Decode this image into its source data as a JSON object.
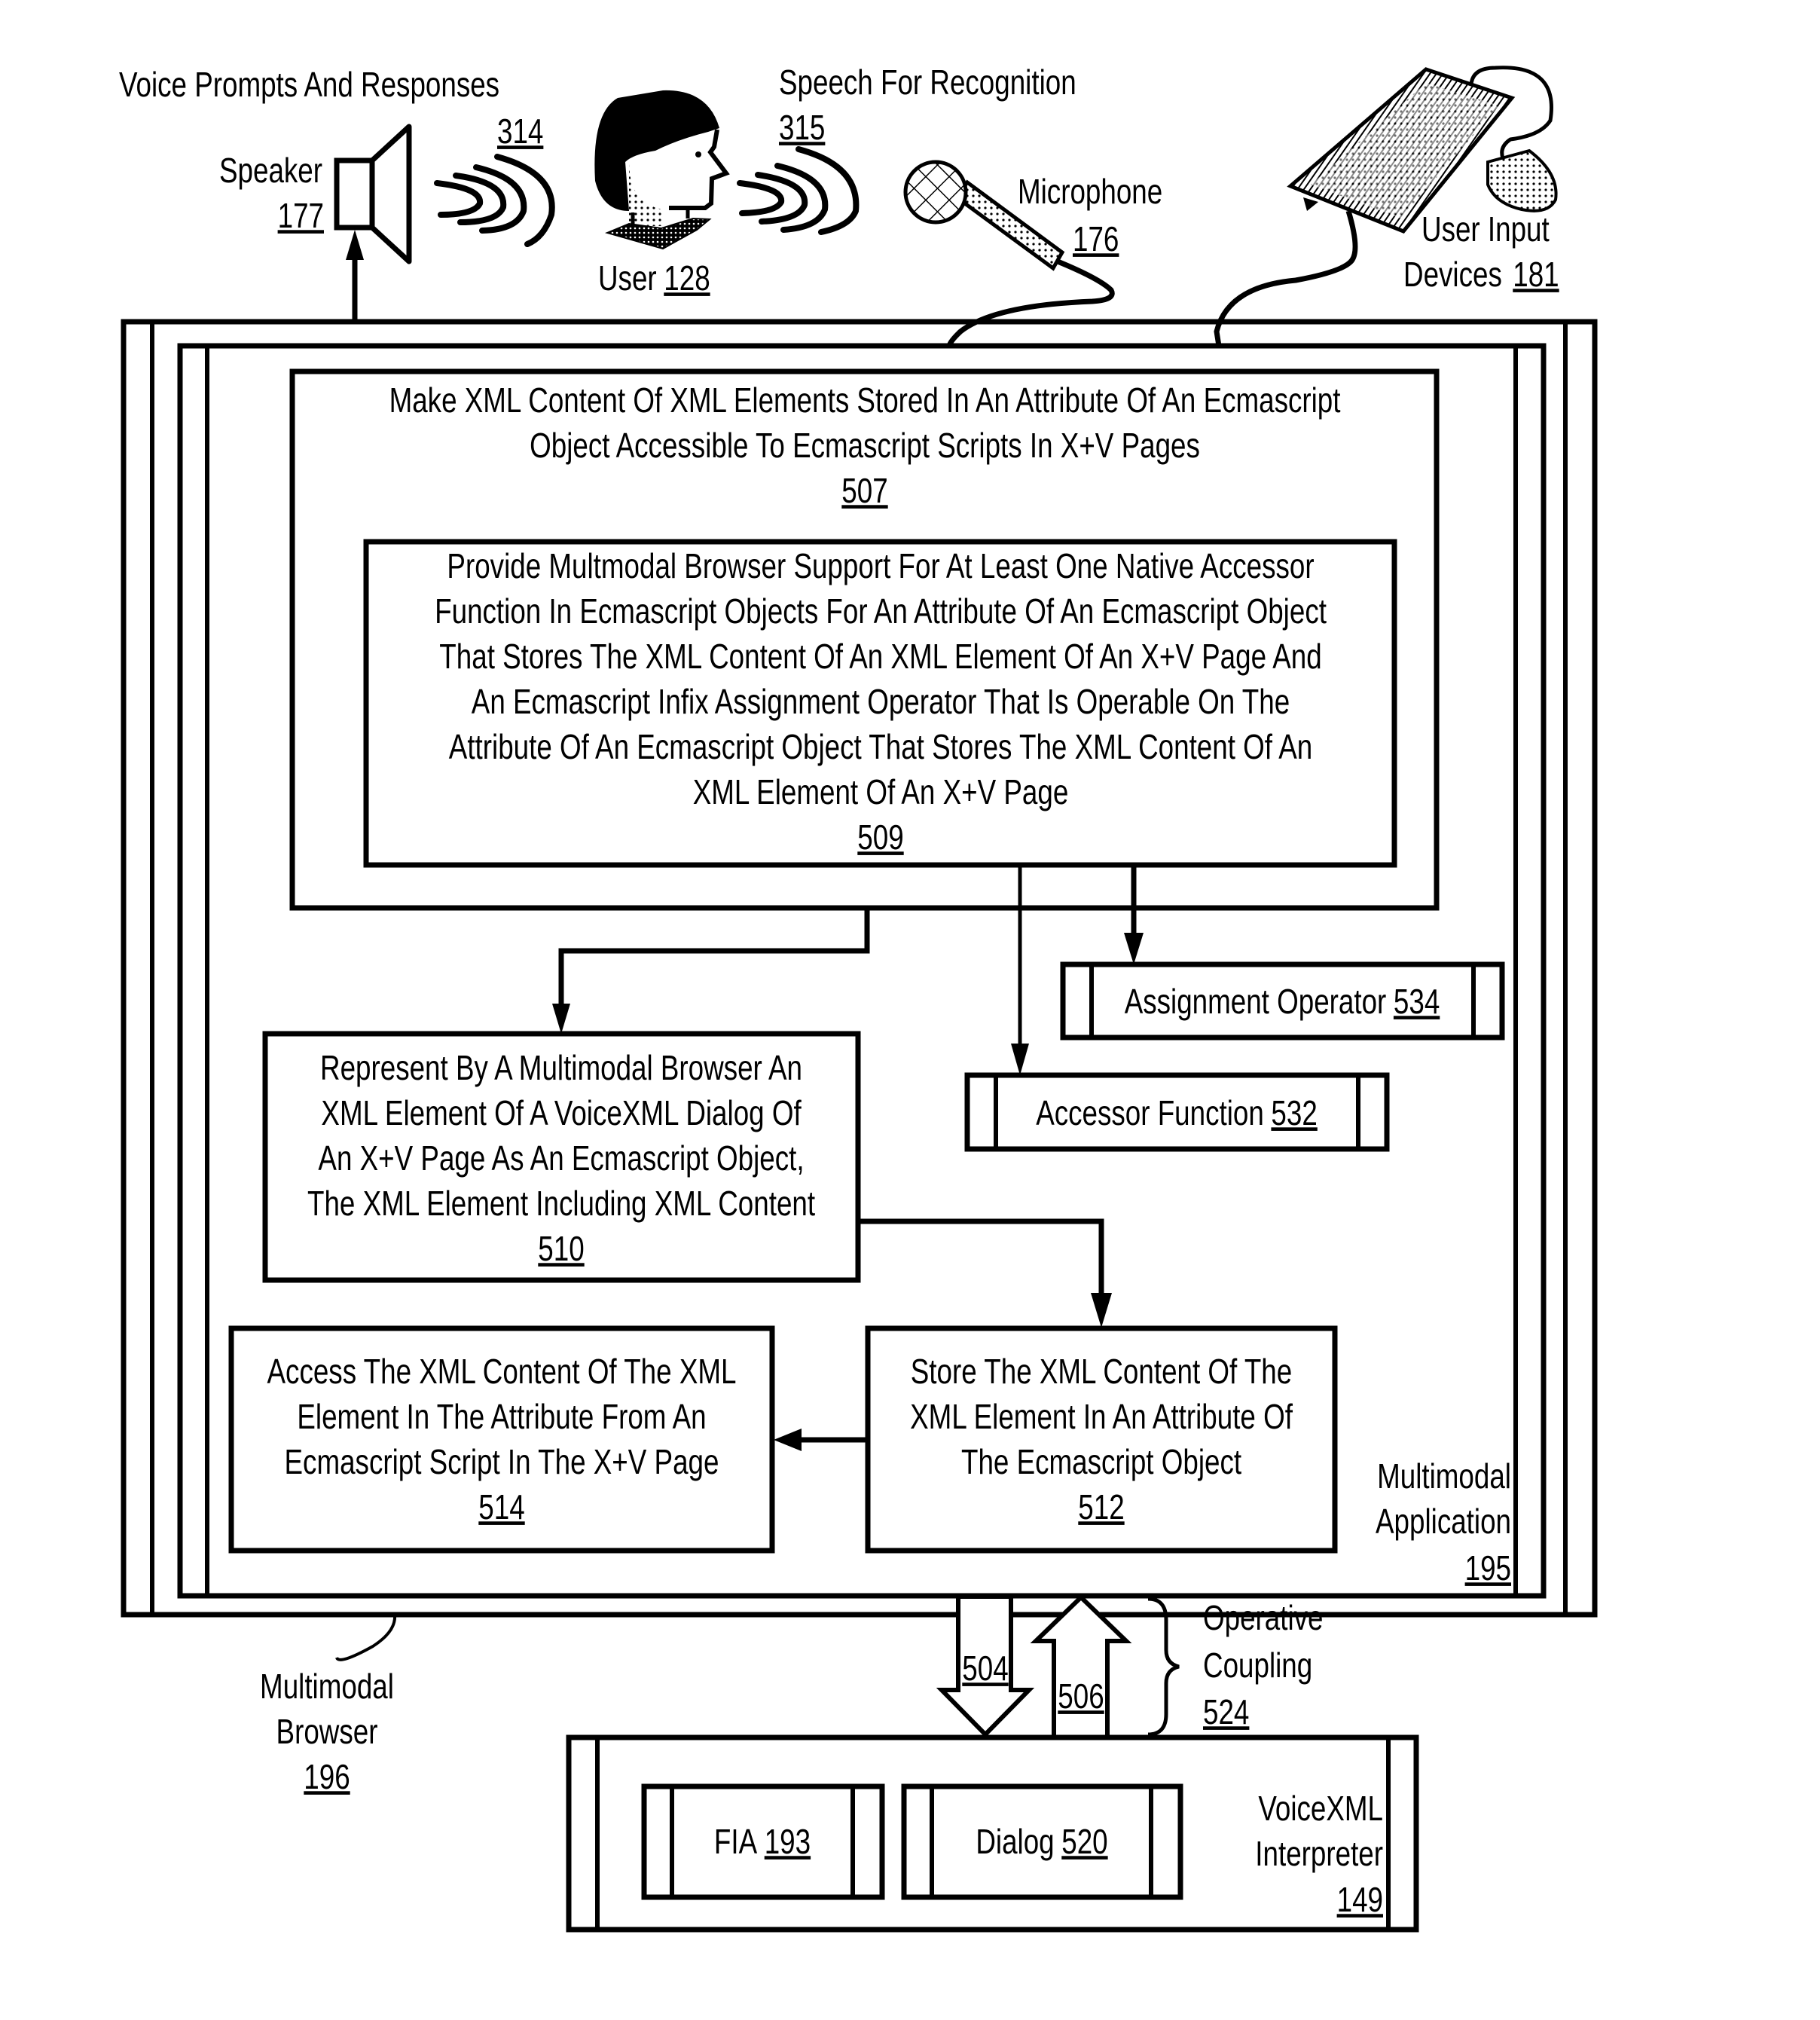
{
  "colors": {
    "ink": "#000000",
    "paper": "#ffffff"
  },
  "peripherals": {
    "voice_prompts": {
      "label": "Voice Prompts And Responses",
      "ref": "314"
    },
    "speaker": {
      "label": "Speaker",
      "ref": "177"
    },
    "user": {
      "label": "User",
      "ref": "128"
    },
    "speech": {
      "label": "Speech For Recognition",
      "ref": "315"
    },
    "microphone": {
      "label": "Microphone",
      "ref": "176"
    },
    "input_devices": {
      "label_line1": "User Input",
      "label_line2": "Devices",
      "ref": "181"
    }
  },
  "boxes": {
    "b507": {
      "lines": [
        "Make XML Content Of XML Elements Stored In An Attribute Of An Ecmascript",
        "Object Accessible To Ecmascript Scripts In X+V Pages"
      ],
      "ref": "507"
    },
    "b509": {
      "lines": [
        "Provide Multmodal Browser Support For At Least One Native Accessor",
        "Function In Ecmascript Objects For An Attribute Of An Ecmascript Object",
        "That Stores The XML Content Of An XML Element Of An X+V Page And",
        "An Ecmascript Infix Assignment Operator That Is Operable On The",
        "Attribute Of An Ecmascript Object That Stores The XML Content Of An",
        "XML Element Of An X+V Page"
      ],
      "ref": "509"
    },
    "b534": {
      "label": "Assignment Operator",
      "ref": "534"
    },
    "b532": {
      "label": "Accessor Function",
      "ref": "532"
    },
    "b510": {
      "lines": [
        "Represent By A Multimodal Browser An",
        "XML Element Of A VoiceXML Dialog Of",
        "An X+V Page As An Ecmascript Object,",
        "The XML Element Including XML Content"
      ],
      "ref": "510"
    },
    "b512": {
      "lines": [
        "Store The XML Content Of The",
        "XML Element In An Attribute Of",
        "The Ecmascript Object"
      ],
      "ref": "512"
    },
    "b514": {
      "lines": [
        "Access The XML Content Of The XML",
        "Element In The Attribute From An",
        "Ecmascript Script In The X+V Page"
      ],
      "ref": "514"
    }
  },
  "containers": {
    "application": {
      "line1": "Multimodal",
      "line2": "Application",
      "ref": "195"
    },
    "browser": {
      "line1": "Multimodal",
      "line2": "Browser",
      "ref": "196"
    },
    "interpreter": {
      "line1": "VoiceXML",
      "line2": "Interpreter",
      "ref": "149"
    },
    "fia": {
      "label": "FIA",
      "ref": "193"
    },
    "dialog": {
      "label": "Dialog",
      "ref": "520"
    }
  },
  "coupling": {
    "down_ref": "504",
    "up_ref": "506",
    "label_line1": "Operative",
    "label_line2": "Coupling",
    "ref": "524"
  }
}
